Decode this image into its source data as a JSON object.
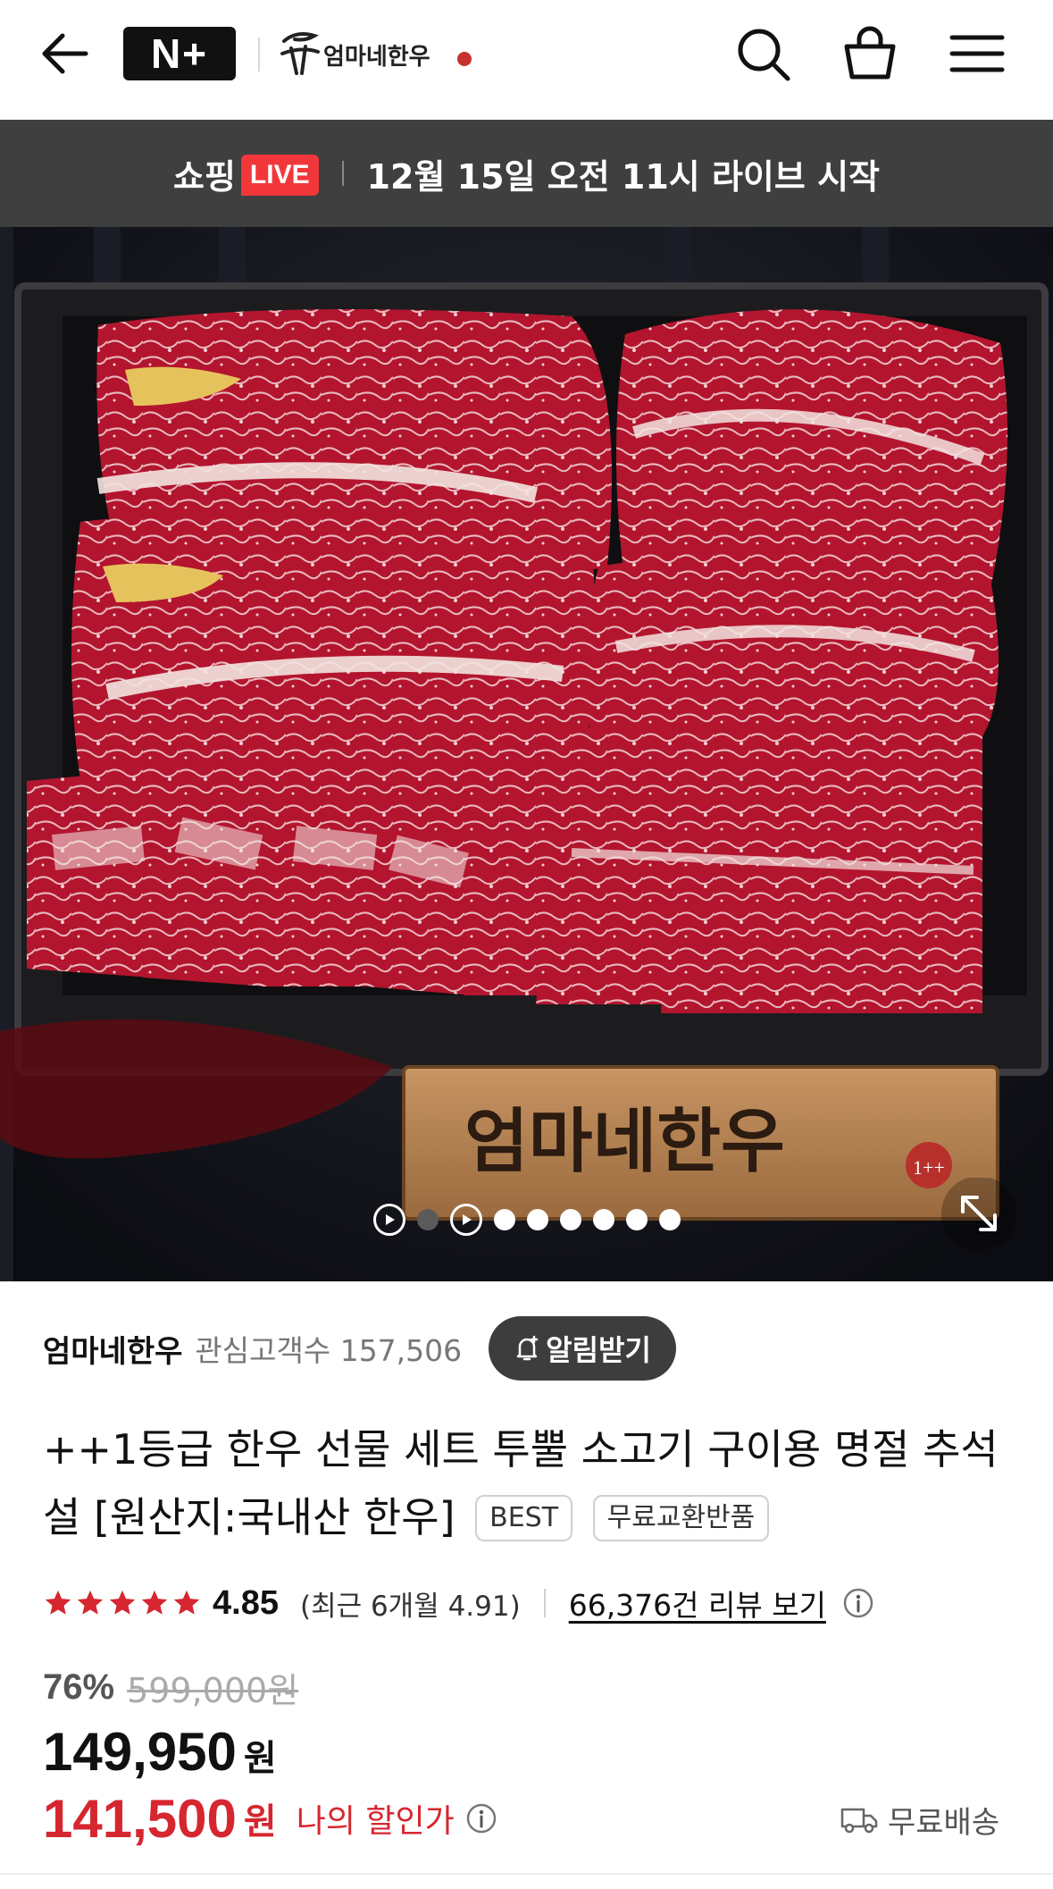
{
  "header": {
    "badge": "N+",
    "store_logo_text": "엄마네한우",
    "icons": [
      "back-arrow-icon",
      "search-icon",
      "shopping-bag-icon",
      "menu-icon"
    ]
  },
  "live_banner": {
    "shopping": "쇼핑",
    "live": "LIVE",
    "schedule": "12월 15일 오전 11시 라이브 시작"
  },
  "hero": {
    "plaque_text": "엄마네한우",
    "grade_badge": "1++",
    "carousel": {
      "total_indicators": 9,
      "active_index": 1
    }
  },
  "store": {
    "name": "엄마네한우",
    "followers_label": "관심고객수 157,506",
    "alarm_button": "알림받기"
  },
  "product": {
    "title": "++1등급 한우 선물 세트 투뿔 소고기 구이용 명절 추석 설 [원산지:국내산 한우]",
    "tags": [
      "BEST",
      "무료교환반품"
    ]
  },
  "rating": {
    "stars": 5,
    "score": "4.85",
    "recent": "(최근 6개월 4.91)",
    "reviews_link": "66,376건 리뷰 보기"
  },
  "price": {
    "discount_rate": "76%",
    "original": "599,000원",
    "sale": "149,950",
    "currency": "원",
    "my_price": "141,500",
    "my_currency": "원",
    "my_label": "나의 할인가",
    "shipping": "무료배송"
  },
  "colors": {
    "accent_red": "#d6262f",
    "live_red": "#f2373b",
    "banner_bg": "#3f3f3f"
  }
}
